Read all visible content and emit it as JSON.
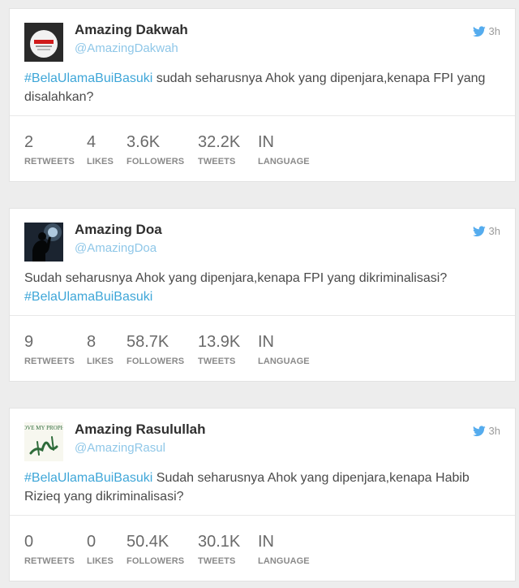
{
  "colors": {
    "hashtag": "#3ea6d8",
    "handle": "#8fc7e8",
    "twitter_bird": "#55acee"
  },
  "tweets": [
    {
      "name": "Amazing Dakwah",
      "handle": "@AmazingDakwah",
      "time": "3h",
      "avatar_icon": "dakwah-logo-avatar",
      "hashtag": "#BelaUlamaBuiBasuki",
      "text": "sudah seharusnya Ahok yang dipenjara,kenapa FPI yang disalahkan?",
      "stats": [
        {
          "value": "2",
          "label": "RETWEETS"
        },
        {
          "value": "4",
          "label": "LIKES"
        },
        {
          "value": "3.6K",
          "label": "FOLLOWERS"
        },
        {
          "value": "32.2K",
          "label": "TWEETS"
        },
        {
          "value": "IN",
          "label": "LANGUAGE"
        }
      ]
    },
    {
      "name": "Amazing Doa",
      "handle": "@AmazingDoa",
      "time": "3h",
      "avatar_icon": "praying-silhouette-avatar",
      "text": "Sudah seharusnya Ahok yang dipenjara,kenapa FPI yang dikriminalisasi?",
      "hashtag": "#BelaUlamaBuiBasuki",
      "stats": [
        {
          "value": "9",
          "label": "RETWEETS"
        },
        {
          "value": "8",
          "label": "LIKES"
        },
        {
          "value": "58.7K",
          "label": "FOLLOWERS"
        },
        {
          "value": "13.9K",
          "label": "TWEETS"
        },
        {
          "value": "IN",
          "label": "LANGUAGE"
        }
      ]
    },
    {
      "name": "Amazing Rasulullah",
      "handle": "@AmazingRasul",
      "time": "3h",
      "avatar_icon": "i-love-my-prophet-avatar",
      "avatar_text": "I LOVE MY PROPHET",
      "hashtag": "#BelaUlamaBuiBasuki",
      "text": "Sudah seharusnya Ahok yang dipenjara,kenapa Habib Rizieq yang dikriminalisasi?",
      "stats": [
        {
          "value": "0",
          "label": "RETWEETS"
        },
        {
          "value": "0",
          "label": "LIKES"
        },
        {
          "value": "50.4K",
          "label": "FOLLOWERS"
        },
        {
          "value": "30.1K",
          "label": "TWEETS"
        },
        {
          "value": "IN",
          "label": "LANGUAGE"
        }
      ]
    }
  ]
}
